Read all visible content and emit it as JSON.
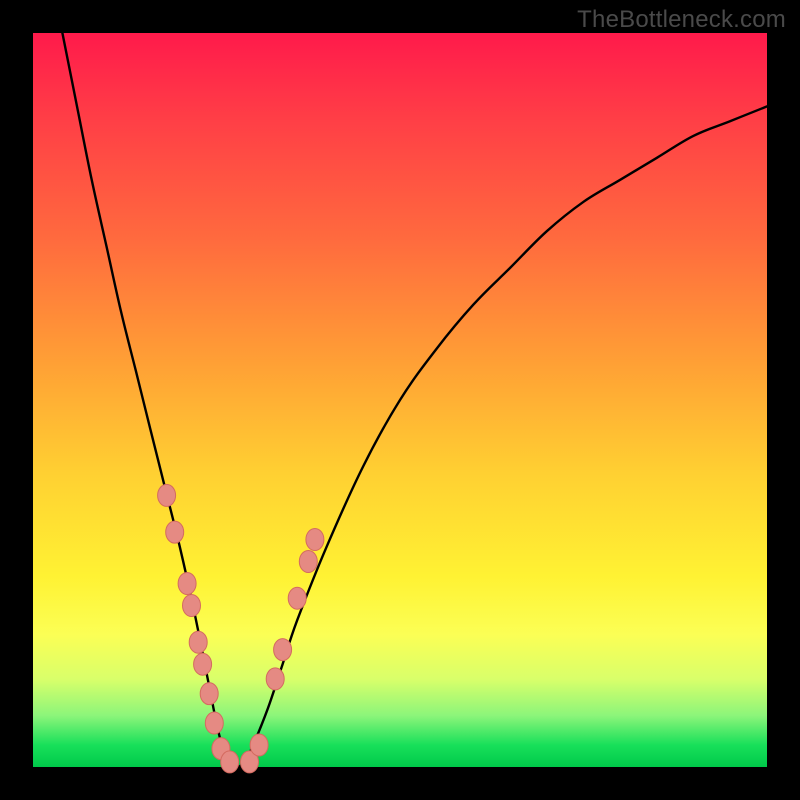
{
  "watermark": "TheBottleneck.com",
  "colors": {
    "frame": "#000000",
    "curve": "#000000",
    "marker_fill": "#e58a83",
    "marker_stroke": "#d46b60"
  },
  "chart_data": {
    "type": "line",
    "title": "",
    "xlabel": "",
    "ylabel": "",
    "xlim": [
      0,
      100
    ],
    "ylim": [
      0,
      100
    ],
    "note": "V-shaped bottleneck curve; y ≈ 0 at the minimum near x ≈ 27, rising steeply on both sides. Values estimated from pixel positions (no axis ticks present).",
    "series": [
      {
        "name": "bottleneck-curve",
        "x": [
          4,
          6,
          8,
          10,
          12,
          14,
          16,
          18,
          20,
          22,
          24,
          25,
          26,
          27,
          28,
          29,
          30,
          32,
          34,
          36,
          40,
          45,
          50,
          55,
          60,
          65,
          70,
          75,
          80,
          85,
          90,
          95,
          100
        ],
        "y": [
          100,
          90,
          80,
          71,
          62,
          54,
          46,
          38,
          30,
          21,
          11,
          6,
          2,
          0,
          0,
          1,
          3,
          8,
          14,
          20,
          30,
          41,
          50,
          57,
          63,
          68,
          73,
          77,
          80,
          83,
          86,
          88,
          90
        ]
      }
    ],
    "markers": {
      "name": "highlighted-points",
      "note": "Salmon dot markers clustering along the lower part of the V.",
      "points": [
        {
          "x": 18.2,
          "y": 37
        },
        {
          "x": 19.3,
          "y": 32
        },
        {
          "x": 21.0,
          "y": 25
        },
        {
          "x": 21.6,
          "y": 22
        },
        {
          "x": 22.5,
          "y": 17
        },
        {
          "x": 23.1,
          "y": 14
        },
        {
          "x": 24.0,
          "y": 10
        },
        {
          "x": 24.7,
          "y": 6
        },
        {
          "x": 25.6,
          "y": 2.5
        },
        {
          "x": 26.8,
          "y": 0.7
        },
        {
          "x": 29.5,
          "y": 0.7
        },
        {
          "x": 30.8,
          "y": 3
        },
        {
          "x": 33.0,
          "y": 12
        },
        {
          "x": 34.0,
          "y": 16
        },
        {
          "x": 36.0,
          "y": 23
        },
        {
          "x": 37.5,
          "y": 28
        },
        {
          "x": 38.4,
          "y": 31
        }
      ]
    }
  }
}
